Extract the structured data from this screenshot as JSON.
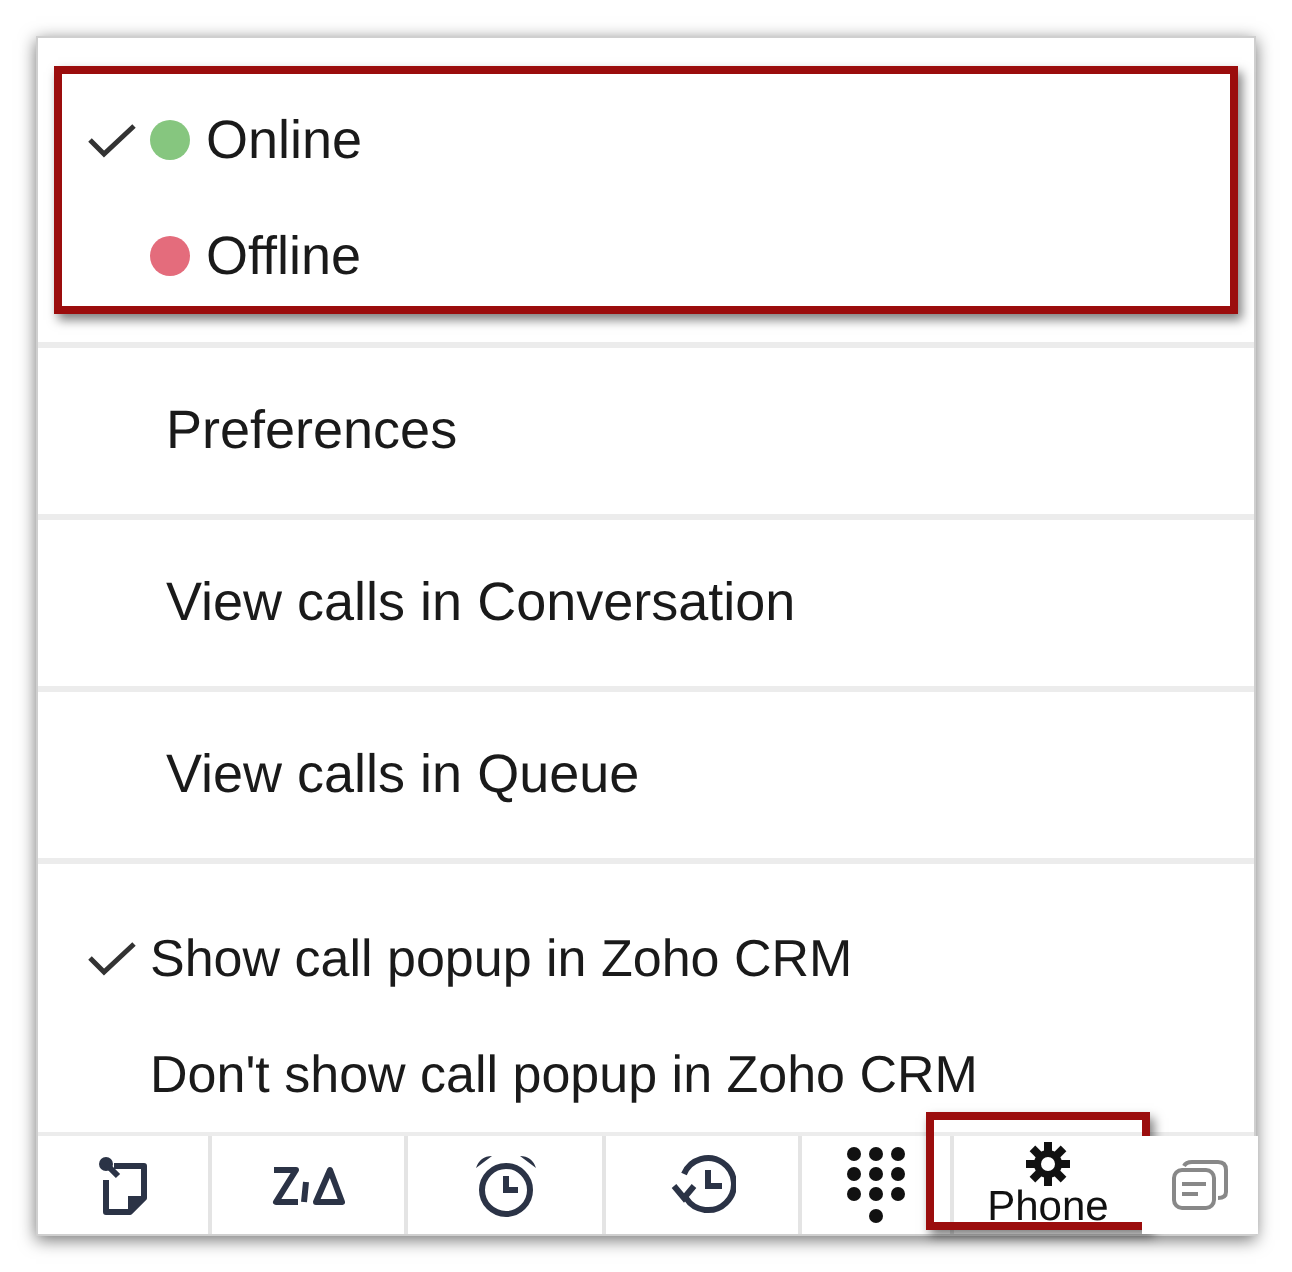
{
  "status_section": {
    "highlighted": true,
    "options": [
      {
        "label": "Online",
        "color": "#86c67f",
        "selected": true
      },
      {
        "label": "Offline",
        "color": "#e46c7c",
        "selected": false
      }
    ]
  },
  "menu_items": [
    "Preferences",
    "View calls in Conversation",
    "View calls in Queue"
  ],
  "popup_options": [
    {
      "label": "Show call popup in Zoho CRM",
      "selected": true
    },
    {
      "label": "Don't show call popup in Zoho CRM",
      "selected": false
    }
  ],
  "toolbar": [
    {
      "kind": "note"
    },
    {
      "kind": "zia"
    },
    {
      "kind": "alarm"
    },
    {
      "kind": "history"
    },
    {
      "kind": "dialpad"
    },
    {
      "kind": "phone",
      "label": "Phone",
      "highlighted": true
    },
    {
      "kind": "chat"
    }
  ]
}
